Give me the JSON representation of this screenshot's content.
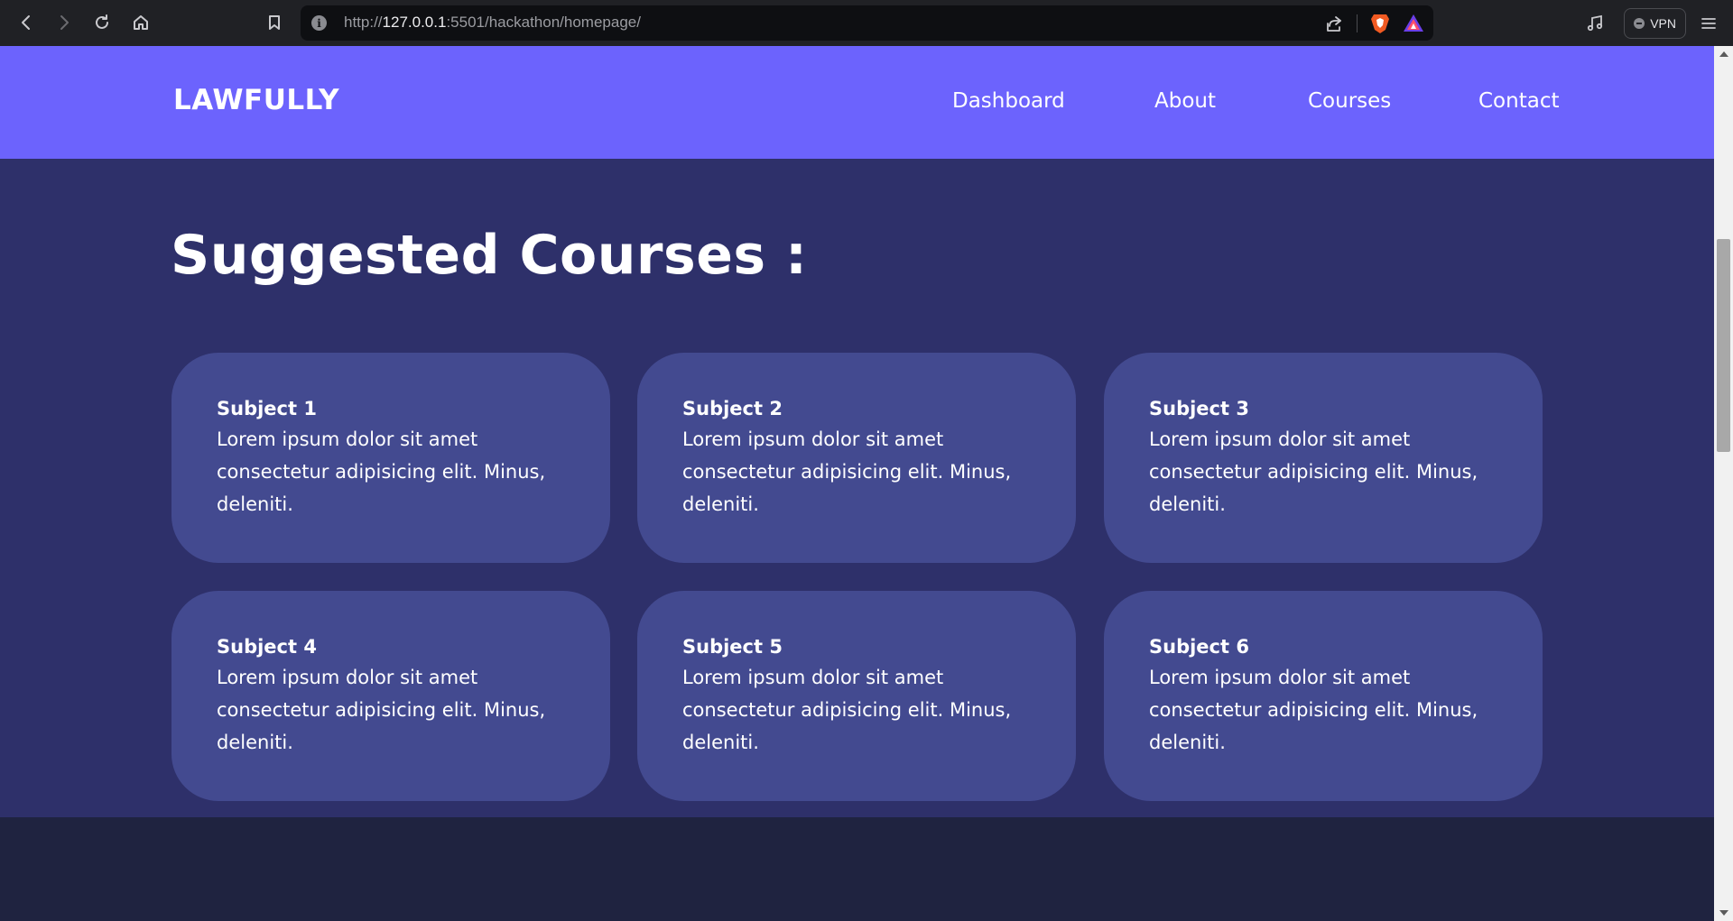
{
  "browser": {
    "url_scheme": "http://",
    "url_host": "127.0.0.1",
    "url_port": ":5501",
    "url_path": "/hackathon/homepage/",
    "vpn_label": "VPN"
  },
  "site": {
    "logo": "LAWFULLY",
    "nav": [
      {
        "label": "Dashboard"
      },
      {
        "label": "About"
      },
      {
        "label": "Courses"
      },
      {
        "label": "Contact"
      }
    ]
  },
  "courses": {
    "title": "Suggested Courses :",
    "items": [
      {
        "title": "Subject 1",
        "text": "Lorem ipsum dolor sit amet consectetur adipisicing elit. Minus, deleniti."
      },
      {
        "title": "Subject 2",
        "text": "Lorem ipsum dolor sit amet consectetur adipisicing elit. Minus, deleniti."
      },
      {
        "title": "Subject 3",
        "text": "Lorem ipsum dolor sit amet consectetur adipisicing elit. Minus, deleniti."
      },
      {
        "title": "Subject 4",
        "text": "Lorem ipsum dolor sit amet consectetur adipisicing elit. Minus, deleniti."
      },
      {
        "title": "Subject 5",
        "text": "Lorem ipsum dolor sit amet consectetur adipisicing elit. Minus, deleniti."
      },
      {
        "title": "Subject 6",
        "text": "Lorem ipsum dolor sit amet consectetur adipisicing elit. Minus, deleniti."
      }
    ]
  },
  "colors": {
    "navbar": "#6c63fd",
    "section": "#2e306a",
    "card": "#434a90",
    "footer": "#1f2340"
  },
  "icons": [
    "back-icon",
    "forward-icon",
    "reload-icon",
    "home-icon",
    "bookmark-icon",
    "info-icon",
    "share-icon",
    "brave-shields-icon",
    "brave-rewards-icon",
    "media-icon",
    "menu-icon"
  ]
}
